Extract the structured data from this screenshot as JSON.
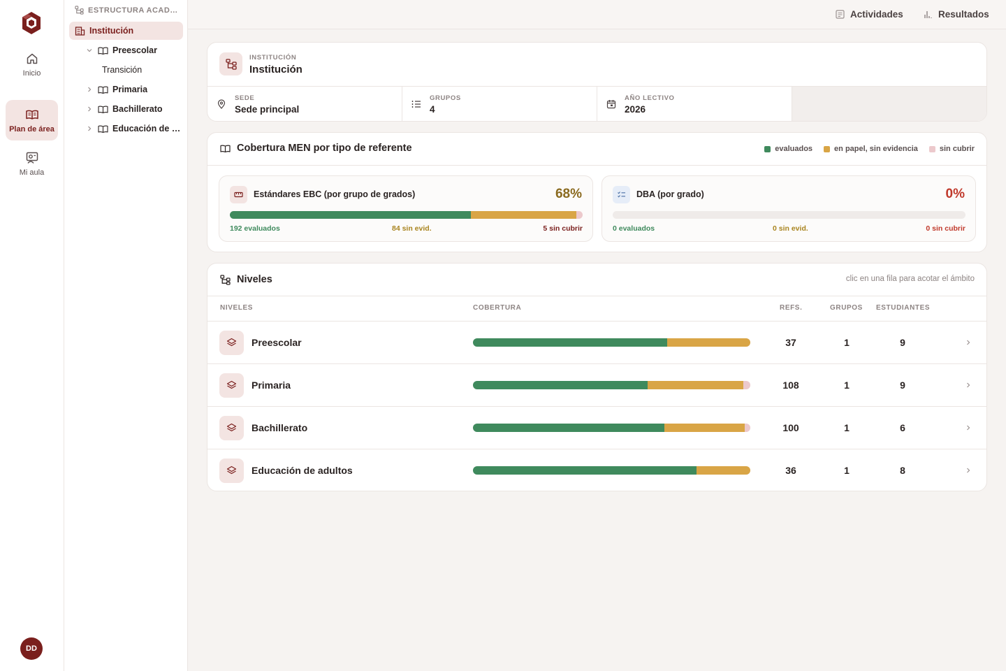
{
  "colors": {
    "accent": "#7a1f1d",
    "evaluados": "#3f8a5d",
    "en_papel": "#d9a546",
    "sin_cubrir": "#ecc9cc",
    "dba_accent": "#c0392b"
  },
  "rail": {
    "items": [
      {
        "label": "Inicio",
        "icon": "home-icon",
        "active": false
      },
      {
        "label": "Plan de área",
        "icon": "book-open-icon",
        "active": true
      },
      {
        "label": "Mi aula",
        "icon": "classroom-icon",
        "active": false
      }
    ],
    "avatar": "DD"
  },
  "tree": {
    "header": "ESTRUCTURA ACAD…",
    "items": [
      {
        "label": "Institución",
        "active": true
      },
      {
        "label": "Preescolar",
        "expanded": true
      },
      {
        "label": "Transición"
      },
      {
        "label": "Primaria"
      },
      {
        "label": "Bachillerato"
      },
      {
        "label": "Educación de …"
      }
    ]
  },
  "topbar": {
    "actividades": "Actividades",
    "resultados": "Resultados"
  },
  "institution": {
    "eyebrow": "INSTITUCIÓN",
    "title": "Institución",
    "stats": [
      {
        "label": "SEDE",
        "value": "Sede principal",
        "icon": "map-pin-icon"
      },
      {
        "label": "GRUPOS",
        "value": "4",
        "icon": "list-icon"
      },
      {
        "label": "AÑO LECTIVO",
        "value": "2026",
        "icon": "calendar-icon"
      }
    ]
  },
  "coverage": {
    "title": "Cobertura MEN por tipo de referente",
    "legend": [
      "evaluados",
      "en papel, sin evidencia",
      "sin cubrir"
    ],
    "boxes": [
      {
        "name": "Estándares EBC (por grupo de grados)",
        "percent": "68%",
        "evaluados_label": "192 evaluados",
        "sin_evid_label": "84 sin evid.",
        "sin_cubrir_label": "5 sin cubrir",
        "evaluados": 192,
        "sin_evid": 84,
        "sin_cubrir": 5
      },
      {
        "name": "DBA (por grado)",
        "percent": "0%",
        "evaluados_label": "0 evaluados",
        "sin_evid_label": "0 sin evid.",
        "sin_cubrir_label": "0 sin cubrir",
        "evaluados": 0,
        "sin_evid": 0,
        "sin_cubrir": 0
      }
    ]
  },
  "levels": {
    "title": "Niveles",
    "hint": "clic en una fila para acotar el ámbito",
    "headers": {
      "niveles": "NIVELES",
      "cobertura": "COBERTURA",
      "refs": "REFS.",
      "grupos": "GRUPOS",
      "estudiantes": "ESTUDIANTES"
    },
    "rows": [
      {
        "name": "Preescolar",
        "refs": "37",
        "grupos": "1",
        "estudiantes": "9",
        "coverage": [
          0.7,
          0.3,
          0.0
        ]
      },
      {
        "name": "Primaria",
        "refs": "108",
        "grupos": "1",
        "estudiantes": "9",
        "coverage": [
          0.63,
          0.345,
          0.025
        ]
      },
      {
        "name": "Bachillerato",
        "refs": "100",
        "grupos": "1",
        "estudiantes": "6",
        "coverage": [
          0.69,
          0.29,
          0.02
        ]
      },
      {
        "name": "Educación de adultos",
        "refs": "36",
        "grupos": "1",
        "estudiantes": "8",
        "coverage": [
          0.805,
          0.195,
          0.0
        ]
      }
    ]
  }
}
